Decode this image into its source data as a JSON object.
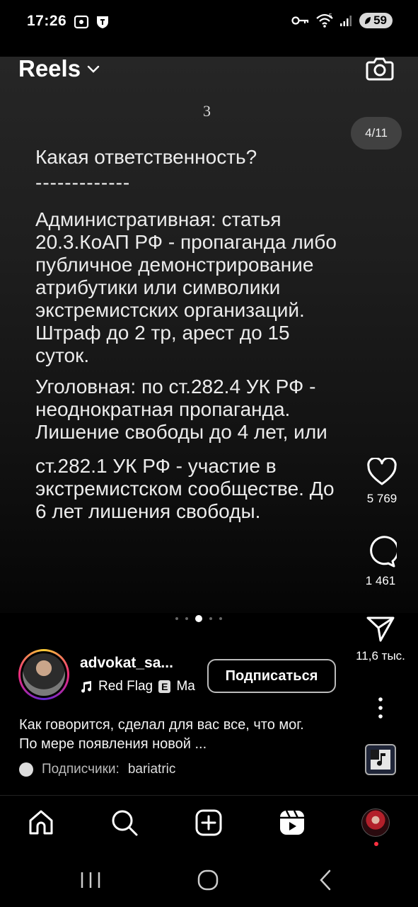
{
  "status_bar": {
    "time": "17:26",
    "battery": "59",
    "network_label": "5"
  },
  "header": {
    "title": "Reels"
  },
  "reel": {
    "page_number": "3",
    "slide_counter": "4/11",
    "text": {
      "question": "Какая ответственность?",
      "divider": "-------------",
      "admin_lines": [
        "Административная: статья",
        "20.3.КоАП РФ - пропаганда либо",
        "публичное демонстрирование",
        "атрибутики или символики",
        "экстремистских организаций.",
        "Штраф до 2 тр, арест до 15",
        "суток."
      ],
      "criminal_lines": [
        "Уголовная: по ст.282.4 УК РФ -",
        "неоднократная пропаганда.",
        "Лишение свободы до 4 лет, или"
      ],
      "criminal2_lines": [
        "ст.282.1 УК РФ - участие в",
        "экстремистском сообществе. До",
        "6 лет лишения свободы."
      ]
    },
    "carousel_active_index": 2
  },
  "actions": {
    "likes": "5 769",
    "comments": "1 461",
    "shares": "11,6 тыс."
  },
  "author": {
    "username": "advokat_sa...",
    "music_text": "Red Flag",
    "explicit_badge": "E",
    "music_extra": "Ma",
    "follow_label": "Подписаться"
  },
  "caption": {
    "line1": "Как говорится, сделал для вас все, что мог.",
    "line2": "По мере появления новой ..."
  },
  "followers": {
    "label": "Подписчики:",
    "name": "bariatric"
  },
  "colors": {
    "accent_red": "#ff3040",
    "background": "#000000",
    "text": "#ffffff"
  }
}
